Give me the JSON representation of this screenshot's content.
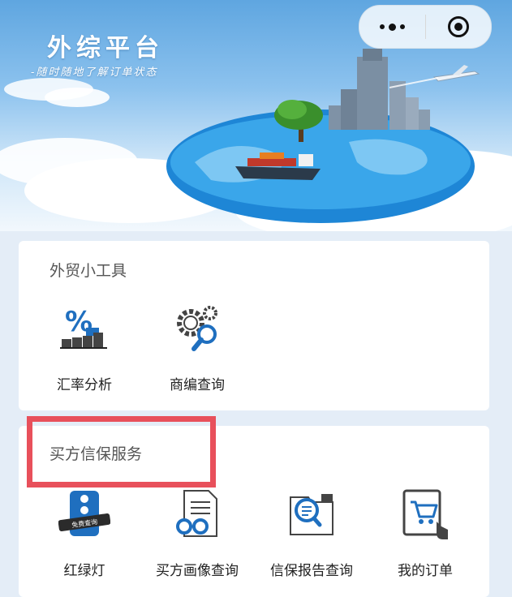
{
  "banner": {
    "title": "外综平台",
    "subtitle": "-随时随地了解订单状态"
  },
  "capsule": {
    "more_icon": "more-dots-icon",
    "close_icon": "target-close-icon"
  },
  "sections": [
    {
      "title": "外贸小工具",
      "items": [
        {
          "label": "汇率分析",
          "icon": "exchange-rate-icon"
        },
        {
          "label": "商编查询",
          "icon": "gear-search-icon"
        }
      ]
    },
    {
      "title": "买方信保服务",
      "items": [
        {
          "label": "红绿灯",
          "icon": "traffic-light-icon",
          "badge": "免费查询"
        },
        {
          "label": "买方画像查询",
          "icon": "document-glasses-icon"
        },
        {
          "label": "信保报告查询",
          "icon": "report-search-icon"
        },
        {
          "label": "我的订单",
          "icon": "tablet-cart-icon"
        }
      ]
    }
  ],
  "colors": {
    "accent_blue": "#1f6fbf",
    "highlight_red": "#e8505b",
    "label_gray": "#555555"
  }
}
